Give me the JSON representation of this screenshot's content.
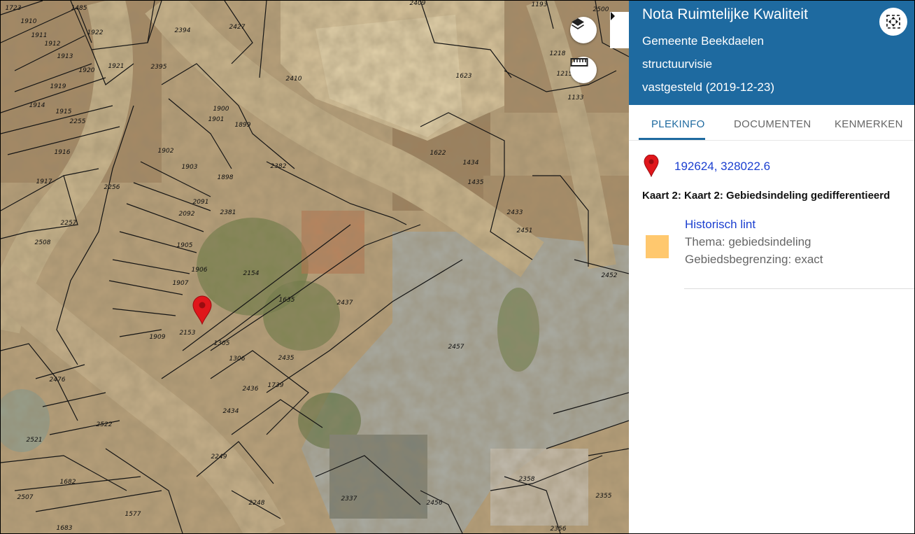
{
  "panel": {
    "title": "Nota Ruimtelijke Kwaliteit",
    "lines": [
      "Gemeente Beekdaelen",
      "structuurvisie",
      "vastgesteld (2019-12-23)"
    ],
    "tabs": [
      {
        "label": "PLEKINFO",
        "active": true
      },
      {
        "label": "DOCUMENTEN",
        "active": false
      },
      {
        "label": "KENMERKEN",
        "active": false
      }
    ],
    "coordinates": "192624, 328022.6",
    "kaart_label": "Kaart 2: Kaart 2: Gebiedsindeling gedifferentieerd",
    "feature": {
      "name": "Historisch lint",
      "thema": "Thema: gebiedsindeling",
      "begrenzing": "Gebiedsbegrenzing: exact",
      "swatch_color": "#ffc86e"
    },
    "header_color": "#1e6aa0"
  },
  "map": {
    "buttons": [
      "layers-icon",
      "ruler-icon"
    ],
    "marker_color": "#e0161b",
    "parcel_labels": [
      "1723",
      "1485",
      "1910",
      "1911",
      "1922",
      "2394",
      "2427",
      "2409",
      "1193",
      "2500",
      "1912",
      "1913",
      "1920",
      "1921",
      "2395",
      "1218",
      "1215",
      "1133",
      "2410",
      "1623",
      "1919",
      "1914",
      "1915",
      "1900",
      "1901",
      "1899",
      "2255",
      "1916",
      "1902",
      "1903",
      "1898",
      "2382",
      "1622",
      "1434",
      "1435",
      "1917",
      "2256",
      "2091",
      "2092",
      "2381",
      "2433",
      "2451",
      "2257",
      "2508",
      "1905",
      "2154",
      "1906",
      "2452",
      "1907",
      "1635",
      "2437",
      "1909",
      "2153",
      "1305",
      "1306",
      "2435",
      "2457",
      "2476",
      "2436",
      "1739",
      "2434",
      "2522",
      "2521",
      "2249",
      "1682",
      "2507",
      "2248",
      "2337",
      "2456",
      "2358",
      "2355",
      "1577",
      "1683",
      "2356"
    ]
  }
}
